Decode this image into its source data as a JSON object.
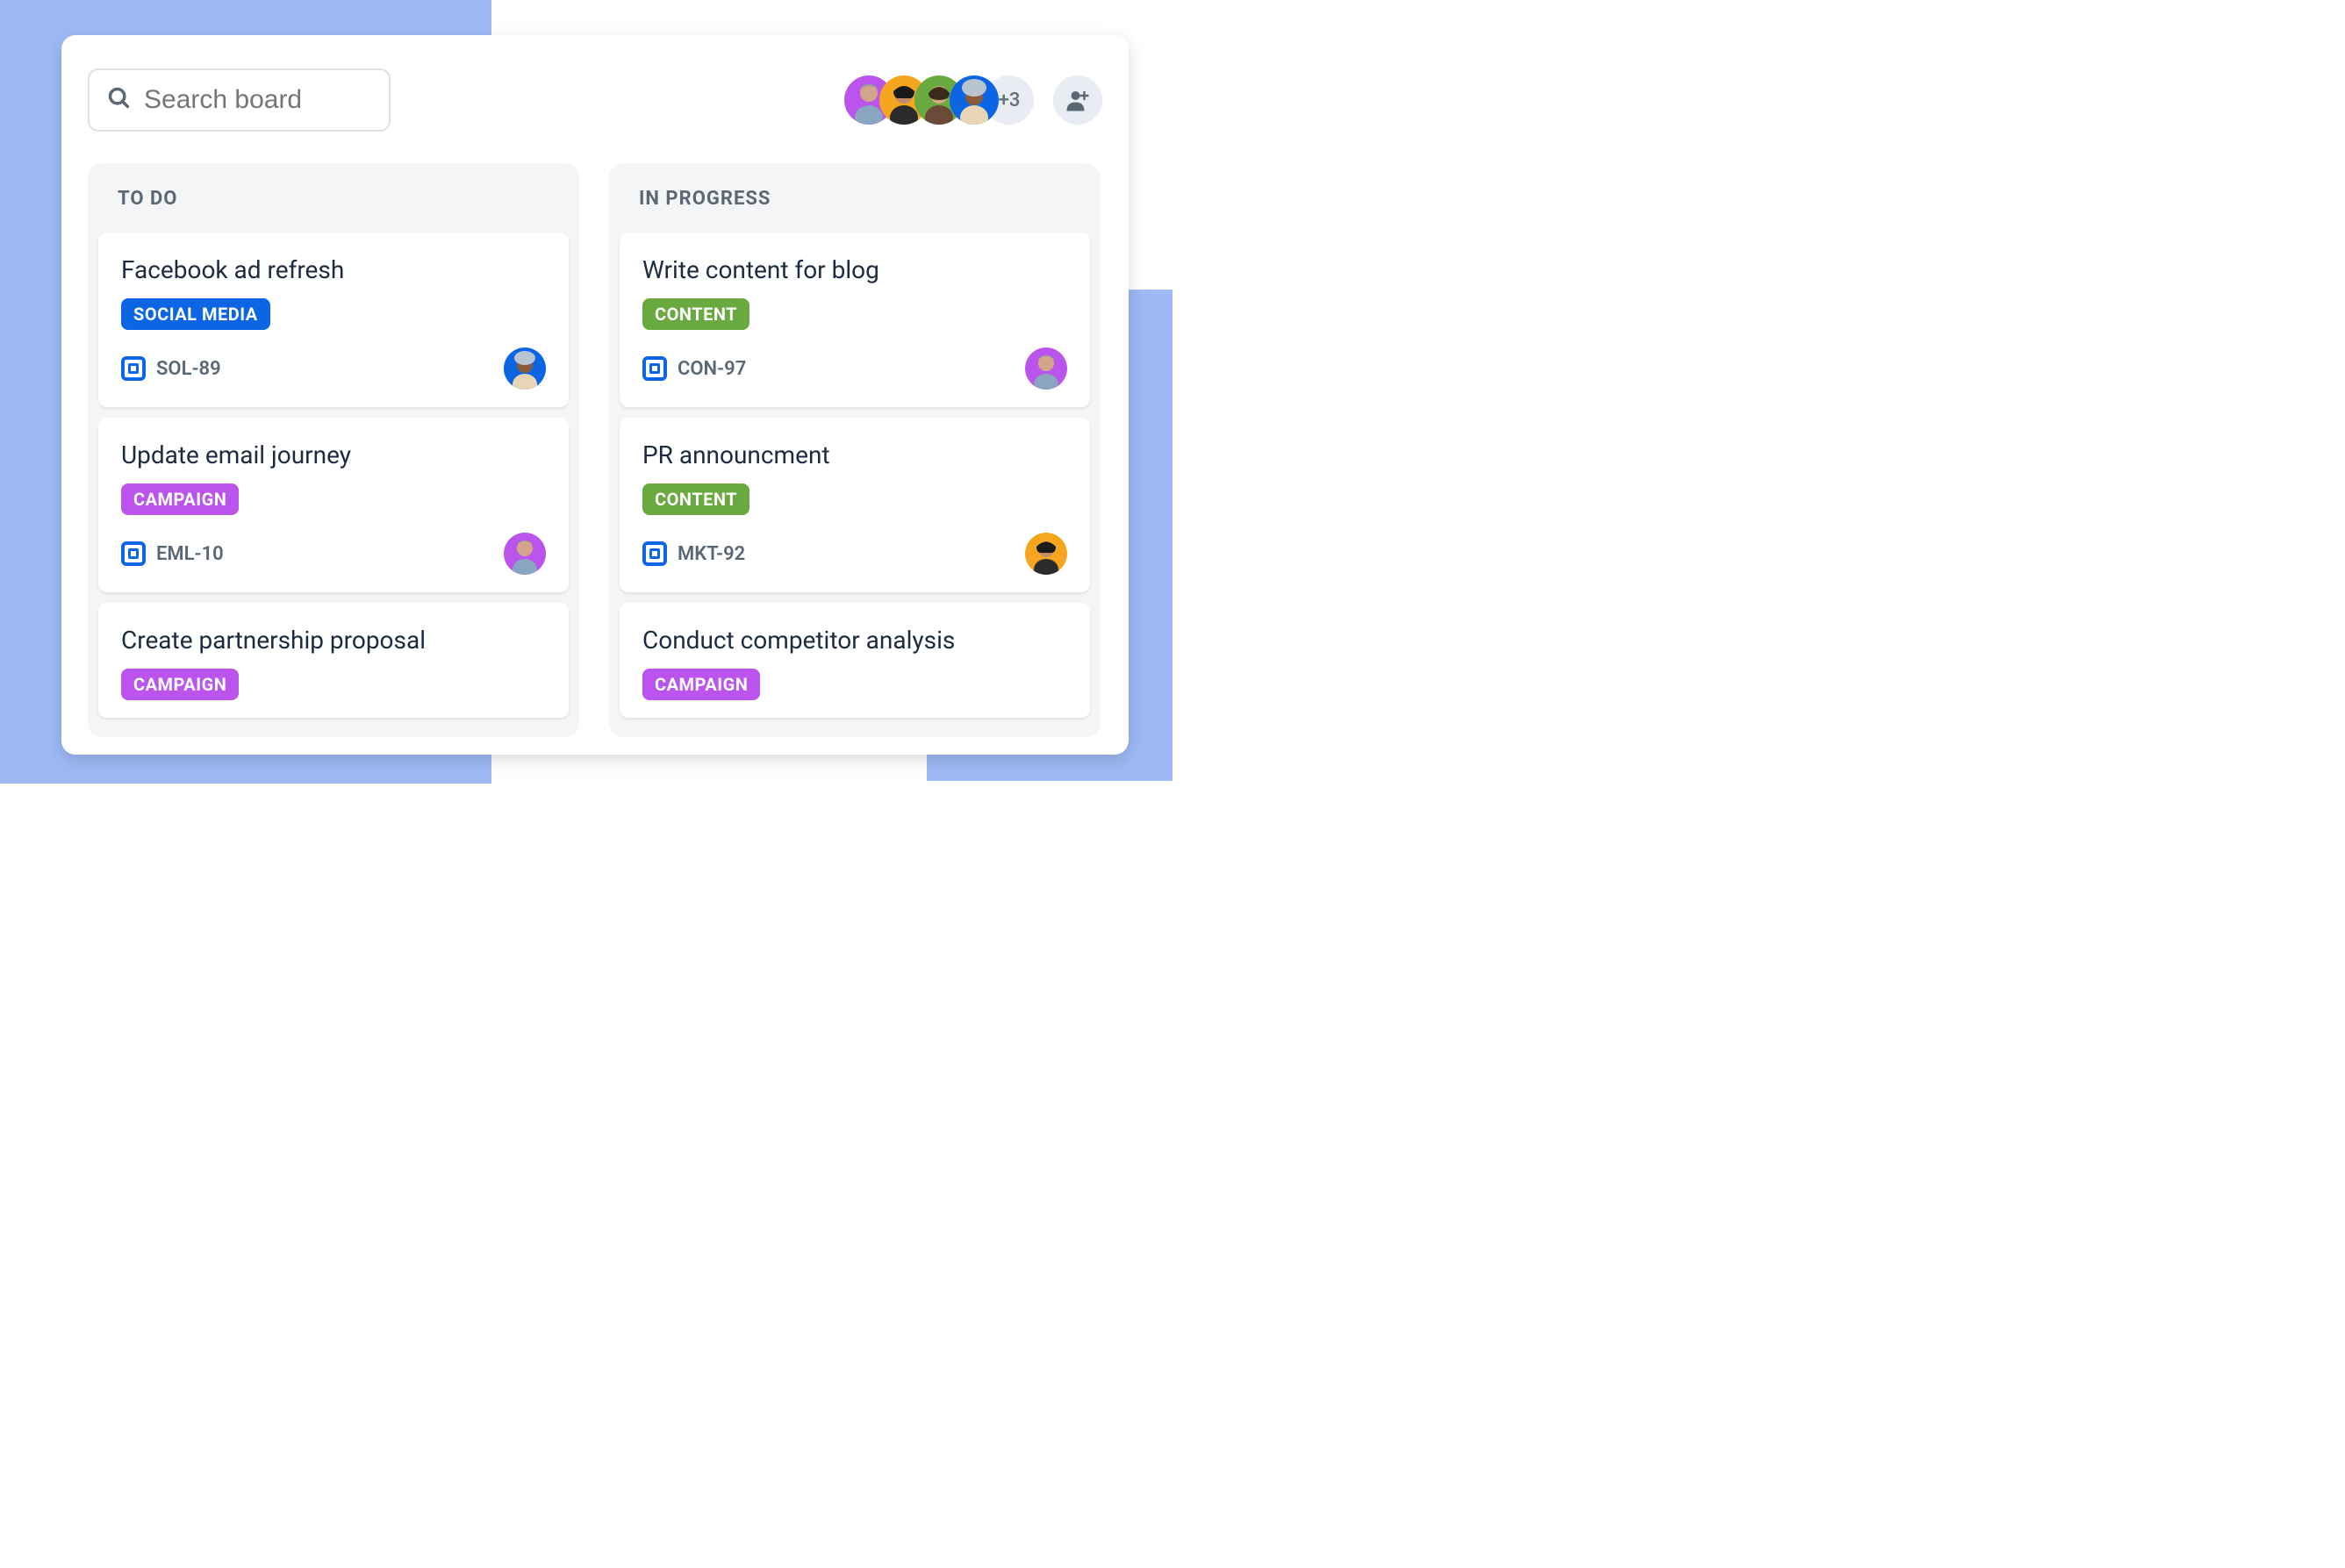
{
  "search": {
    "placeholder": "Search board"
  },
  "avatars": {
    "overflow_count": "+3",
    "colors": [
      "#BA54EC",
      "#F6A61E",
      "#6AA840",
      "#0C66E4"
    ]
  },
  "columns": [
    {
      "title": "TO DO",
      "cards": [
        {
          "title": "Facebook ad refresh",
          "tag": "SOCIAL MEDIA",
          "tag_color": "blue",
          "id": "SOL-89",
          "avatar_color": "#0C66E4"
        },
        {
          "title": "Update email journey",
          "tag": "CAMPAIGN",
          "tag_color": "purple",
          "id": "EML-10",
          "avatar_color": "#BA54EC"
        },
        {
          "title": "Create partnership proposal",
          "tag": "CAMPAIGN",
          "tag_color": "purple",
          "partial": true
        }
      ]
    },
    {
      "title": "IN PROGRESS",
      "cards": [
        {
          "title": "Write content for blog",
          "tag": "CONTENT",
          "tag_color": "green",
          "id": "CON-97",
          "avatar_color": "#BA54EC"
        },
        {
          "title": "PR announcment",
          "tag": "CONTENT",
          "tag_color": "green",
          "id": "MKT-92",
          "avatar_color": "#F6A61E"
        },
        {
          "title": "Conduct competitor analysis",
          "tag": "CAMPAIGN",
          "tag_color": "purple",
          "partial": true
        }
      ]
    }
  ]
}
